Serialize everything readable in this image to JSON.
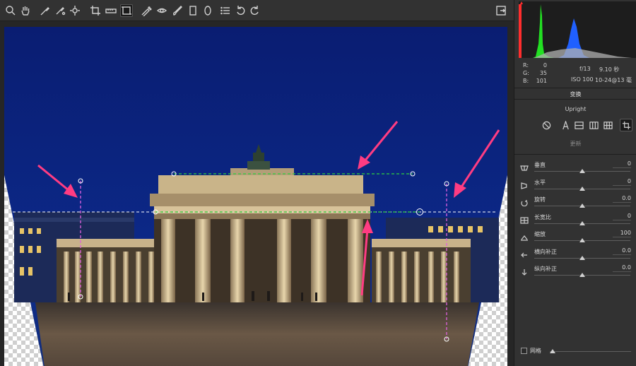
{
  "toolbar": {
    "tools": [
      {
        "name": "zoom-icon"
      },
      {
        "name": "hand-icon"
      },
      {
        "name": "white-balance-icon"
      },
      {
        "name": "color-sampler-icon"
      },
      {
        "name": "target-adjust-icon"
      },
      {
        "name": "crop-icon"
      },
      {
        "name": "straighten-icon"
      },
      {
        "name": "transform-icon"
      },
      {
        "name": "spot-removal-icon"
      },
      {
        "name": "red-eye-icon"
      },
      {
        "name": "brush-icon"
      },
      {
        "name": "graduated-filter-icon"
      },
      {
        "name": "radial-filter-icon"
      },
      {
        "name": "presets-list-icon"
      },
      {
        "name": "rotate-left-icon"
      },
      {
        "name": "rotate-right-icon"
      }
    ],
    "export_icon": "export-icon"
  },
  "readout": {
    "r_label": "R:",
    "r_value": "0",
    "g_label": "G:",
    "g_value": "35",
    "b_label": "B:",
    "b_value": "101"
  },
  "exif": {
    "aperture": "f/13",
    "shutter": "9.10 秒",
    "iso": "ISO 100",
    "lens": "10-24@13 毫"
  },
  "transform": {
    "section_title": "变换",
    "upright_label": "Upright",
    "upright_buttons": [
      "off-icon",
      "auto-icon",
      "level-icon",
      "vertical-icon",
      "full-icon",
      "guided-icon"
    ],
    "update_label": "更新"
  },
  "sliders": [
    {
      "icon": "vertical-perspective-icon",
      "label": "垂直",
      "value": "0",
      "position": 0.5
    },
    {
      "icon": "horizontal-perspective-icon",
      "label": "水平",
      "value": "0",
      "position": 0.5
    },
    {
      "icon": "rotate-icon",
      "label": "旋转",
      "value": "0.0",
      "position": 0.5
    },
    {
      "icon": "aspect-icon",
      "label": "长宽比",
      "value": "0",
      "position": 0.5
    },
    {
      "icon": "scale-icon",
      "label": "缩放",
      "value": "100",
      "position": 0.5
    },
    {
      "icon": "x-offset-icon",
      "label": "横向补正",
      "value": "0.0",
      "position": 0.5
    },
    {
      "icon": "y-offset-icon",
      "label": "纵向补正",
      "value": "0.0",
      "position": 0.5
    }
  ],
  "grid": {
    "label": "网格",
    "checked": false,
    "position": 0.0
  },
  "colors": {
    "sky": "#0a1f7a",
    "accent_arrow": "#ff3c82",
    "guide_green": "#2fcf3f",
    "guide_magenta": "#e060e0"
  }
}
